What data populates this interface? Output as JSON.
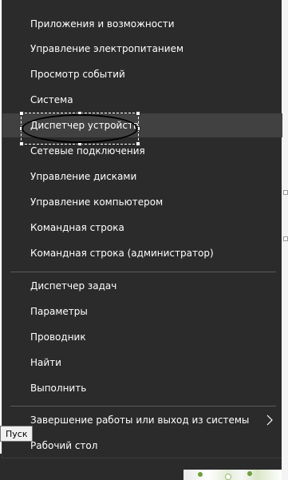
{
  "menu": {
    "group1": [
      {
        "id": "apps",
        "label": "Приложения и возможности"
      },
      {
        "id": "power",
        "label": "Управление электропитанием"
      },
      {
        "id": "events",
        "label": "Просмотр событий"
      },
      {
        "id": "system",
        "label": "Система"
      },
      {
        "id": "device-manager",
        "label": "Диспетчер устройств"
      },
      {
        "id": "network",
        "label": "Сетевые подключения"
      },
      {
        "id": "disks",
        "label": "Управление дисками"
      },
      {
        "id": "computer-mgmt",
        "label": "Управление компьютером"
      },
      {
        "id": "cmd",
        "label": "Командная строка"
      },
      {
        "id": "cmd-admin",
        "label": "Командная строка (администратор)"
      }
    ],
    "group2": [
      {
        "id": "task-manager",
        "label": "Диспетчер задач"
      },
      {
        "id": "settings",
        "label": "Параметры"
      },
      {
        "id": "explorer",
        "label": "Проводник"
      },
      {
        "id": "search",
        "label": "Найти"
      },
      {
        "id": "run",
        "label": "Выполнить"
      }
    ],
    "group3": [
      {
        "id": "shutdown",
        "label": "Завершение работы или выход из системы",
        "submenu": true
      },
      {
        "id": "desktop",
        "label": "Рабочий стол"
      }
    ],
    "highlighted": "device-manager",
    "submenu_icon": "chevron-right-icon"
  },
  "tooltip": {
    "text": "Пуск"
  },
  "colors": {
    "menu_bg": "#2b2b2b",
    "highlight_bg": "#414141",
    "text": "#ffffff",
    "separator": "#5a5a5a"
  }
}
